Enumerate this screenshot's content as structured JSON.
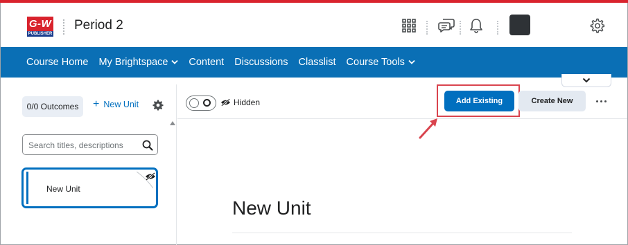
{
  "header": {
    "logo_text": "G-W",
    "logo_sub": "PUBLISHER",
    "course_title": "Period 2",
    "icons": [
      "apps-grid-icon",
      "chat-icon",
      "bell-icon",
      "avatar",
      "gear-icon"
    ]
  },
  "nav": {
    "items": [
      {
        "label": "Course Home",
        "has_menu": false
      },
      {
        "label": "My Brightspace",
        "has_menu": true
      },
      {
        "label": "Content",
        "has_menu": false
      },
      {
        "label": "Discussions",
        "has_menu": false
      },
      {
        "label": "Classlist",
        "has_menu": false
      },
      {
        "label": "Course Tools",
        "has_menu": true
      }
    ],
    "chevron": "⌄"
  },
  "left_panel": {
    "outcomes_label": "0/0 Outcomes",
    "new_unit_label": "New Unit",
    "new_unit_plus": "+",
    "search_placeholder": "Search titles, descriptions",
    "unit_card_label": "New Unit"
  },
  "toolbar": {
    "hidden_label": "Hidden",
    "add_existing_label": "Add Existing",
    "create_new_label": "Create New"
  },
  "main": {
    "unit_heading": "New Unit"
  },
  "colors": {
    "brand_red": "#d9232d",
    "nav_blue": "#0a6fb5",
    "primary_blue": "#006fbf",
    "annotation_red": "#d9444e"
  }
}
